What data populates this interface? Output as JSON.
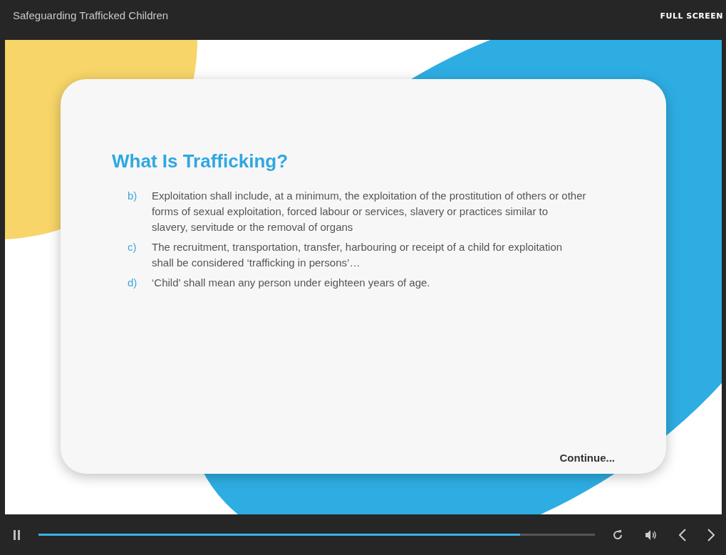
{
  "window": {
    "title": "Safeguarding Trafficked Children",
    "full_screen_label": "FULL SCREEN"
  },
  "slide": {
    "heading": "What Is Trafficking?",
    "items": [
      {
        "marker": "b)",
        "text": "Exploitation shall include, at a minimum, the exploitation of the prostitution of others or other forms of sexual exploitation, forced labour or services, slavery or practices similar to slavery, servitude or the removal of organs"
      },
      {
        "marker": "c)",
        "text": "The recruitment, transportation, transfer, harbouring or receipt of a child for exploitation shall be considered ‘trafficking in persons’…"
      },
      {
        "marker": "d)",
        "text": "‘Child’ shall mean any person under eighteen years of age."
      }
    ],
    "continue_label": "Continue..."
  },
  "player": {
    "progress": {
      "level": 0.865
    }
  }
}
